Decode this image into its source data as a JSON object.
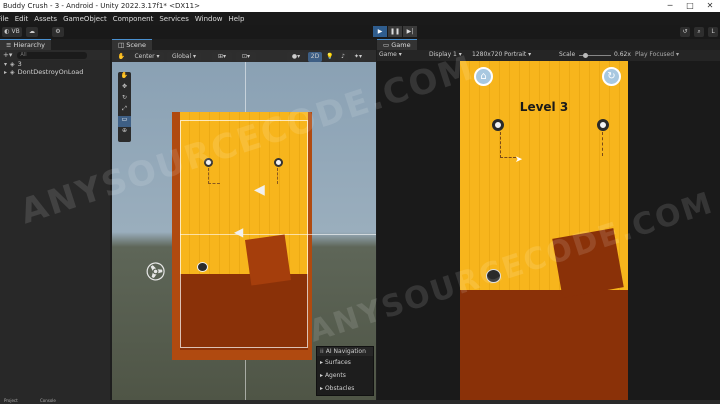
{
  "window": {
    "title": "Buddy Crush - 3 - Android - Unity 2022.3.17f1* <DX11>"
  },
  "menu": [
    "File",
    "Edit",
    "Assets",
    "GameObject",
    "Component",
    "Services",
    "Window",
    "Help"
  ],
  "toolbar": {
    "account": "VB"
  },
  "hierarchy": {
    "tab": "Hierarchy",
    "search_placeholder": "All",
    "items": [
      "3",
      "DontDestroyOnLoad"
    ]
  },
  "scene": {
    "tab": "Scene",
    "pivot": "Center",
    "space": "Global",
    "mode_2d": "2D",
    "overlay": {
      "title": "AI Navigation",
      "items": [
        "Surfaces",
        "Agents",
        "Obstacles"
      ]
    }
  },
  "game": {
    "tab": "Game",
    "view_select": "Game",
    "display": "Display 1",
    "resolution": "1280x720 Portrait",
    "scale_label": "Scale",
    "scale_value": "0.62x",
    "play_focused": "Play Focused",
    "level_title": "Level 3"
  },
  "watermark": "ANYSOURCECODE.COM",
  "bottom": {
    "project_tab": "Project",
    "console_tab": "Console"
  },
  "colors": {
    "wood": "#f7b51c",
    "ground": "#8a3108",
    "play_active": "#2f5d8e",
    "unity_dark": "#282828"
  }
}
